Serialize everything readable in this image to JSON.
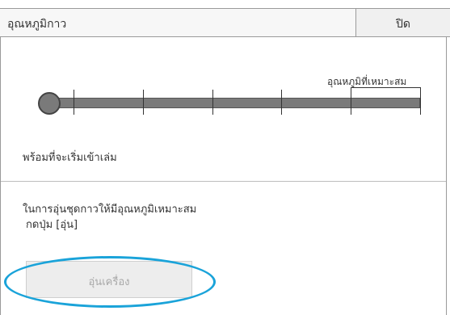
{
  "header": {
    "title": "อุณหภูมิกาว",
    "close_label": "ปิด"
  },
  "temperature": {
    "optimal_label": "อุณหภูมิที่เหมาะสม",
    "level_fraction": 0.0
  },
  "status": {
    "text": "พร้อมที่จะเริ่มเข้าเล่ม"
  },
  "instructions": {
    "line1": "ในการอุ่นชุดกาวให้มีอุณหภูมิเหมาะสม",
    "line2": "กดปุ่ม [อุ่น]"
  },
  "warm_button": {
    "label": "อุ่นเครื่อง",
    "enabled": false
  },
  "colors": {
    "highlight": "#1aa3d9",
    "track": "#7a7a7a"
  }
}
